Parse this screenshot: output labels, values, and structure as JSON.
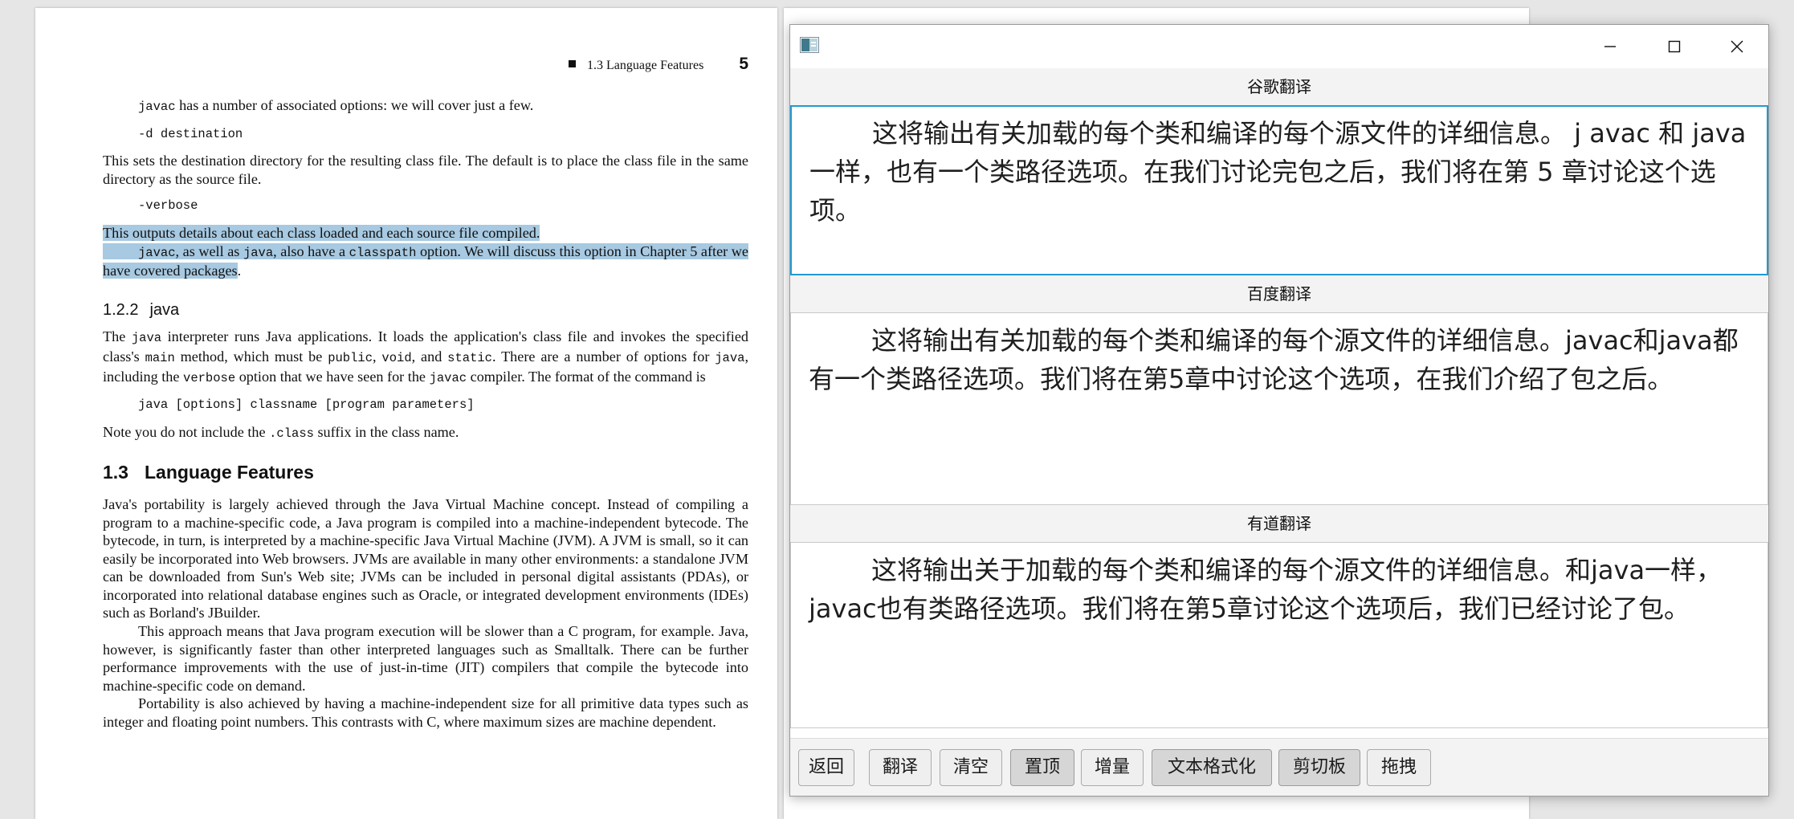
{
  "pdf": {
    "running_head": {
      "section": "1.3  Language Features",
      "page": "5"
    },
    "p1": {
      "a": "javac",
      "b": " has a number of associated options: we will cover just a few."
    },
    "code1": "-d destination",
    "p2": "This sets the destination directory for the resulting class file. The default is to place the class file in the same directory as the source file.",
    "code2": "-verbose",
    "hl1": "This outputs details about each class loaded and each source file compiled.",
    "hl2": {
      "a": "javac",
      "b": ", as well as ",
      "c": "java",
      "d": ", also have a ",
      "e": "classpath",
      "f": " option. We will discuss this option in Chapter 5 after we have covered packages",
      "g": "."
    },
    "h122": {
      "num": "1.2.2",
      "title": "java"
    },
    "p3": {
      "a": "The ",
      "b": "java",
      "c": " interpreter runs Java applications. It loads the application's class file and invokes the specified class's ",
      "d": "main",
      "e": " method, which must be ",
      "f": "public",
      "g": ", ",
      "h": "void",
      "i": ", and ",
      "j": "static",
      "k": ". There are a number of options for ",
      "l": "java",
      "m": ", including the ",
      "n": "verbose",
      "o": " option that we have seen for the ",
      "p": "javac",
      "q": " compiler. The format of the command is"
    },
    "code3": "java [options] classname  [program parameters]",
    "p4": {
      "a": "Note you do not include the ",
      "b": ".class",
      "c": " suffix in the class name."
    },
    "h13": {
      "num": "1.3",
      "title": "Language Features"
    },
    "p5": "Java's portability is largely achieved through the Java Virtual Machine concept. Instead of compiling a program to a machine-specific code, a Java program is compiled into a machine-independent bytecode. The bytecode, in turn, is interpreted by a machine-specific Java Virtual Machine (JVM). A JVM is small, so it can easily be incorporated into Web browsers. JVMs are available in many other environments: a standalone JVM can be downloaded from Sun's Web site; JVMs can be included in personal digital assistants (PDAs), or incorporated into relational database engines such as Oracle, or integrated development environments (IDEs) such as Borland's JBuilder.",
    "p6": "This approach means that Java program execution will be slower than a C program, for example. Java, however, is significantly faster than other interpreted languages such as Smalltalk. There can be further performance improvements with the use of just-in-time (JIT) compilers that compile the bytecode into machine-specific code on demand.",
    "p7": "Portability is also achieved by having a machine-independent size for all primitive data types such as integer and floating point numbers. This contrasts with C, where maximum sizes are machine dependent."
  },
  "window": {
    "panes": [
      {
        "label": "谷歌翻译",
        "text": "这将输出有关加载的每个类和编译的每个源文件的详细信息。 j avac 和 java 一样，也有一个类路径选项。在我们讨论完包之后，我们将在第 5 章讨论这个选项。"
      },
      {
        "label": "百度翻译",
        "text": "这将输出有关加载的每个类和编译的每个源文件的详细信息。javac和java都有一个类路径选项。我们将在第5章中讨论这个选项，在我们介绍了包之后。"
      },
      {
        "label": "有道翻译",
        "text": "这将输出关于加载的每个类和编译的每个源文件的详细信息。和java一样，javac也有类路径选项。我们将在第5章讨论这个选项后，我们已经讨论了包。"
      }
    ],
    "buttons": {
      "back": "返回",
      "translate": "翻译",
      "clear": "清空",
      "pin_top": "置顶",
      "incremental": "增量",
      "text_format": "文本格式化",
      "clipboard": "剪切板",
      "drag": "拖拽"
    }
  }
}
